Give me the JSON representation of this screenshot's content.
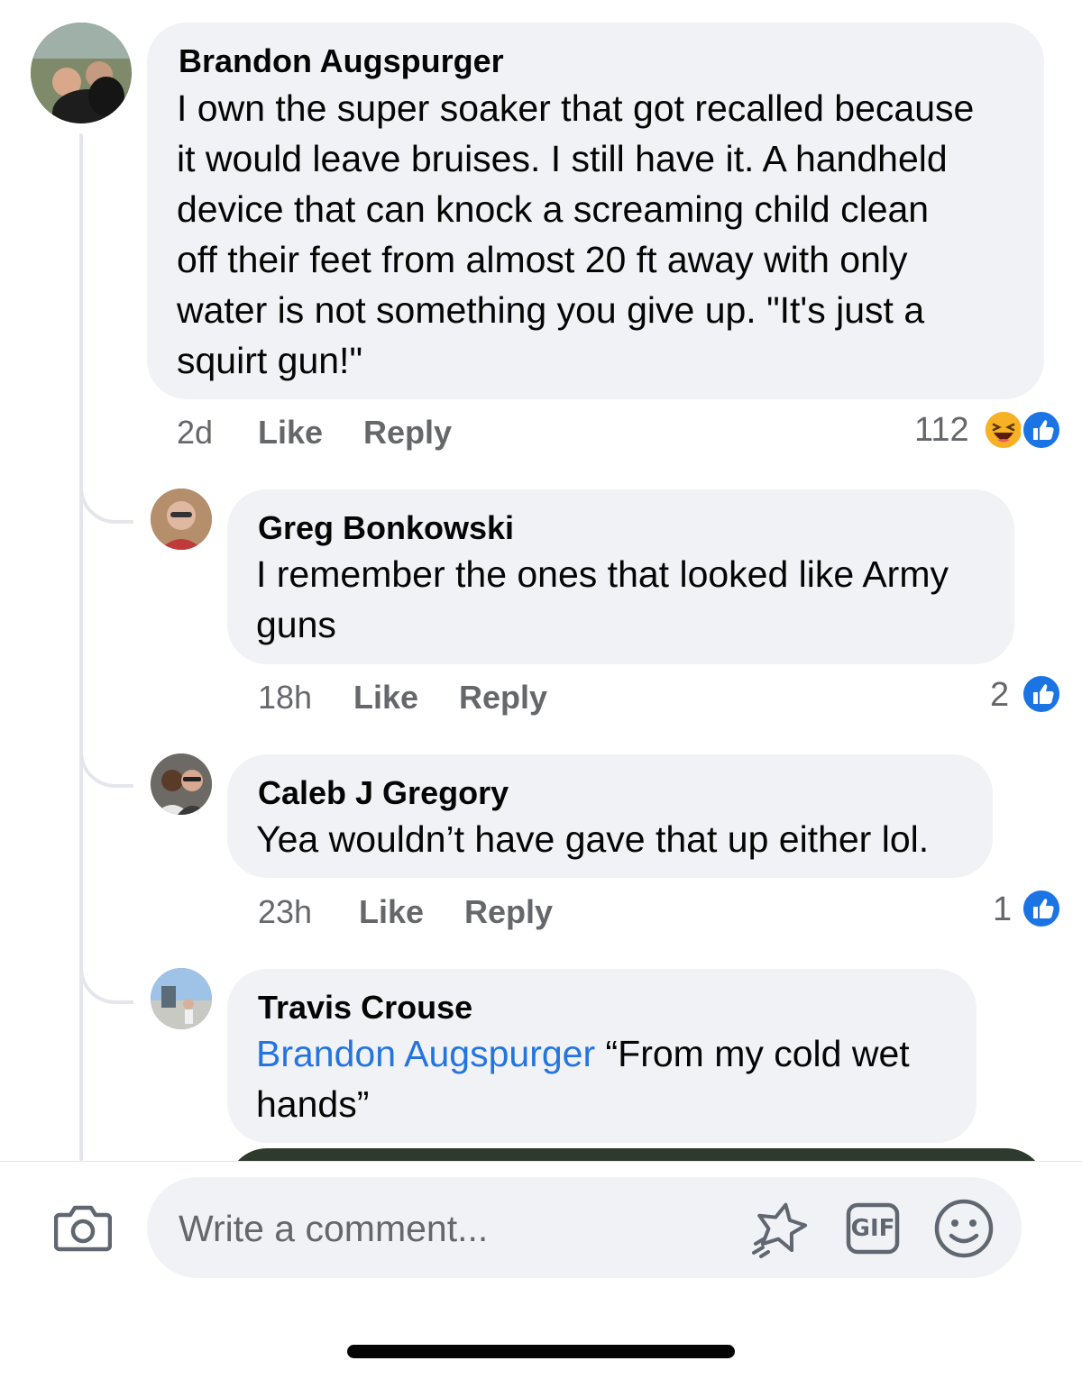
{
  "comments": [
    {
      "author": "Brandon Augspurger",
      "lines": [
        "I own the super soaker that got recalled because",
        "it would leave bruises. I still have it. A handheld",
        "device that can knock a screaming child clean",
        "off their feet from almost 20 ft away with only",
        "water is not something you give up. \"It's just a",
        "squirt gun!\""
      ],
      "time": "2d",
      "like_label": "Like",
      "reply_label": "Reply",
      "reaction_count": "112",
      "reactions": [
        "haha-icon",
        "like-icon"
      ]
    }
  ],
  "replies": [
    {
      "author": "Greg Bonkowski",
      "lines": [
        "I remember the ones that looked like Army",
        "guns"
      ],
      "time": "18h",
      "like_label": "Like",
      "reply_label": "Reply",
      "reaction_count": "2",
      "reactions": [
        "like-icon"
      ]
    },
    {
      "author": "Caleb J Gregory",
      "lines": [
        "Yea wouldn’t have gave that up either lol."
      ],
      "time": "23h",
      "like_label": "Like",
      "reply_label": "Reply",
      "reaction_count": "1",
      "reactions": [
        "like-icon"
      ]
    },
    {
      "author": "Travis Crouse",
      "mention": "Brandon Augspurger",
      "lines": [
        " “From my cold wet",
        "hands”"
      ]
    }
  ],
  "composer": {
    "placeholder": "Write a comment...",
    "icons": [
      "camera-icon",
      "avatar-sticker-icon",
      "gif-icon",
      "emoji-icon"
    ],
    "gif_label": "GIF"
  },
  "colors": {
    "bubble": "#f0f2f5",
    "mention": "#2374e1",
    "meta": "#65676b",
    "like_blue": "#1b74e4",
    "thread_line": "#e4e6eb"
  }
}
